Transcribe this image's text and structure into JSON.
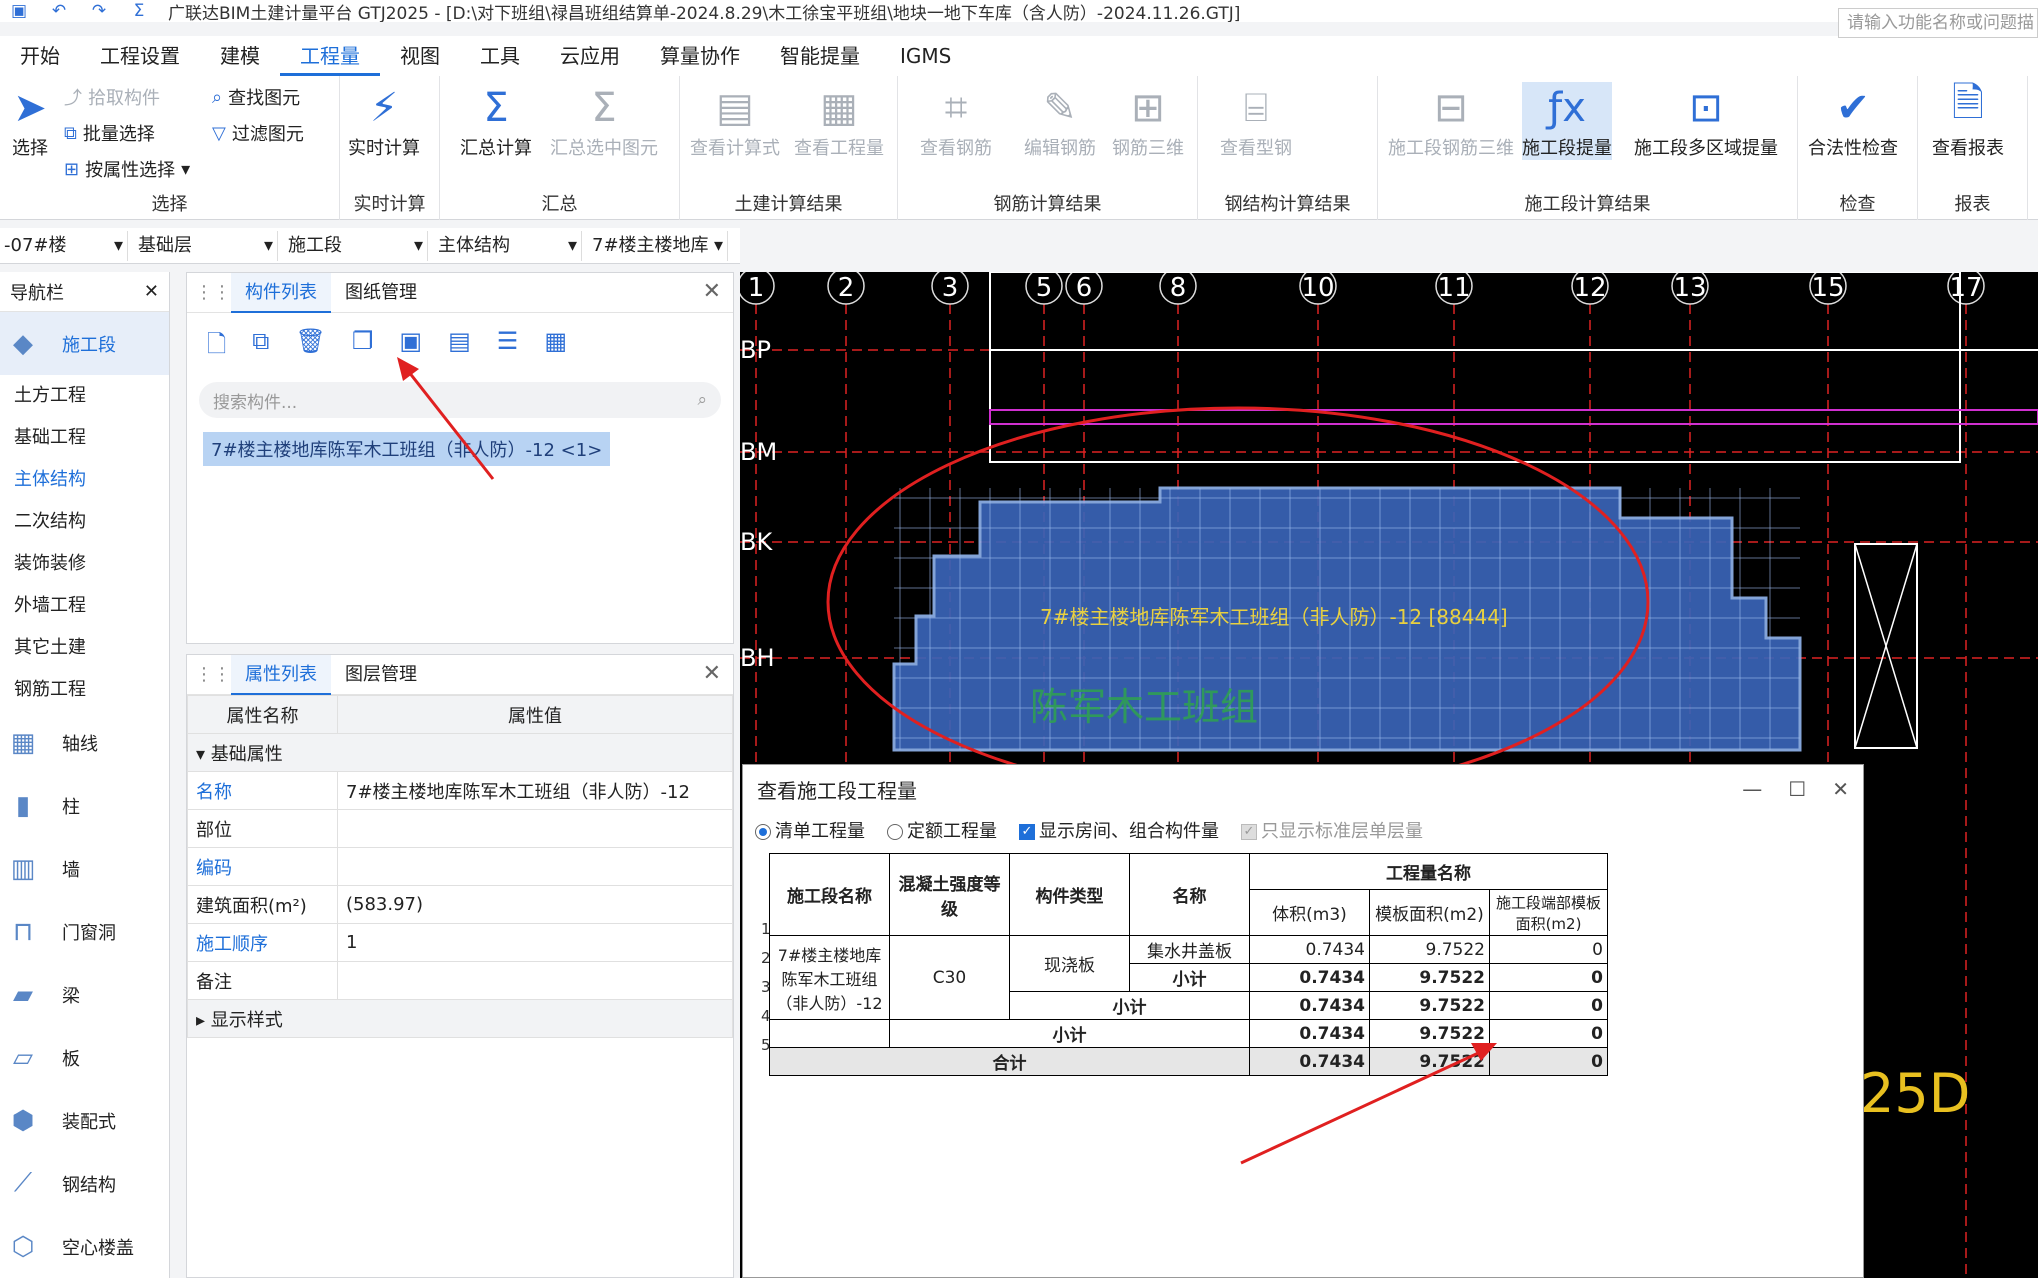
{
  "title": "广联达BIM土建计量平台 GTJ2025 - [D:\\对下班组\\禄昌班组结算单-2024.8.29\\木工徐宝平班组\\地块一地下车库（含人防）-2024.11.26.GTJ]",
  "menu": [
    "开始",
    "工程设置",
    "建模",
    "工程量",
    "视图",
    "工具",
    "云应用",
    "算量协作",
    "智能提量",
    "IGMS"
  ],
  "active_menu": "工程量",
  "search_func_placeholder": "请输入功能名称或问题描",
  "ribbon": {
    "select": {
      "label": "选择",
      "pick": "拾取构件",
      "batch": "批量选择",
      "byprop": "按属性选择",
      "find": "查找图元",
      "filter": "过滤图元",
      "group": "选择"
    },
    "realtime": {
      "label": "实时计算",
      "group": "实时计算"
    },
    "summary": {
      "label": "汇总计算",
      "sel": "汇总选中图元",
      "group": "汇总"
    },
    "civil": {
      "formula": "查看计算式",
      "qty": "查看工程量",
      "group": "土建计算结果"
    },
    "rebar": {
      "view": "查看钢筋",
      "edit": "编辑钢筋",
      "three": "钢筋三维",
      "group": "钢筋计算结果"
    },
    "steel": {
      "view": "查看型钢",
      "group": "钢结构计算结果"
    },
    "section": {
      "three": "施工段钢筋三维",
      "extract": "施工段提量",
      "multi": "施工段多区域提量",
      "group": "施工段计算结果"
    },
    "check": {
      "label": "合法性检查",
      "group": "检查"
    },
    "report": {
      "label": "查看报表",
      "group": "报表"
    }
  },
  "dropdowns": [
    "-07#楼",
    "基础层",
    "施工段",
    "主体结构",
    "7#楼主楼地库"
  ],
  "nav": {
    "title": "导航栏",
    "active": "施工段",
    "sections": [
      "土方工程",
      "基础工程",
      "主体结构",
      "二次结构",
      "装饰装修",
      "外墙工程",
      "其它土建",
      "钢筋工程"
    ],
    "active_section": "主体结构",
    "items": [
      "轴线",
      "柱",
      "墙",
      "门窗洞",
      "梁",
      "板",
      "装配式",
      "钢结构",
      "空心楼盖"
    ]
  },
  "complist": {
    "tabs": [
      "构件列表",
      "图纸管理"
    ],
    "search": "搜索构件...",
    "item": "7#楼主楼地库陈军木工班组（非人防）-12 <1>"
  },
  "proplist": {
    "tabs": [
      "属性列表",
      "图层管理"
    ],
    "headers": [
      "属性名称",
      "属性值"
    ],
    "section": "基础属性",
    "rows": [
      {
        "k": "名称",
        "v": "7#楼主楼地库陈军木工班组（非人防）-12",
        "blue": true
      },
      {
        "k": "部位",
        "v": "",
        "blue": false
      },
      {
        "k": "编码",
        "v": "",
        "blue": true
      },
      {
        "k": "建筑面积(m²)",
        "v": "(583.97)",
        "blue": false
      },
      {
        "k": "施工顺序",
        "v": "1",
        "blue": true
      },
      {
        "k": "备注",
        "v": "",
        "blue": false
      }
    ],
    "section2": "显示样式"
  },
  "cad": {
    "axes_top": [
      "1",
      "2",
      "3",
      "5",
      "6",
      "8",
      "10",
      "11",
      "12",
      "13",
      "15",
      "17"
    ],
    "axes_left": [
      "BP",
      "BM",
      "BK",
      "BH"
    ],
    "label": "7#楼主楼地库陈军木工班组（非人防）-12 [88444]",
    "watermark": "陈军木工班组",
    "partial": "25D"
  },
  "dialog": {
    "title": "查看施工段工程量",
    "opt1": "清单工程量",
    "opt2": "定额工程量",
    "opt3": "显示房间、组合构件量",
    "opt4": "只显示标准层单层量",
    "headers": {
      "section": "施工段名称",
      "grade": "混凝土强度等级",
      "type": "构件类型",
      "name": "名称",
      "qty": "工程量名称",
      "vol": "体积(m3)",
      "form": "模板面积(m2)",
      "end": "施工段端部模板面积(m2)"
    },
    "section_name": "7#楼主楼地库陈军木工班组（非人防）-12",
    "grade": "C30",
    "type": "现浇板",
    "rows": [
      {
        "name": "集水井盖板",
        "vol": "0.7434",
        "form": "9.7522",
        "end": "0"
      },
      {
        "name": "小计",
        "vol": "0.7434",
        "form": "9.7522",
        "end": "0"
      }
    ],
    "sub1": {
      "label": "小计",
      "vol": "0.7434",
      "form": "9.7522",
      "end": "0"
    },
    "sub2": {
      "label": "小计",
      "vol": "0.7434",
      "form": "9.7522",
      "end": "0"
    },
    "total": {
      "label": "合计",
      "vol": "0.7434",
      "form": "9.7522",
      "end": "0"
    },
    "rownums": [
      "1",
      "2",
      "3",
      "4",
      "5"
    ]
  }
}
